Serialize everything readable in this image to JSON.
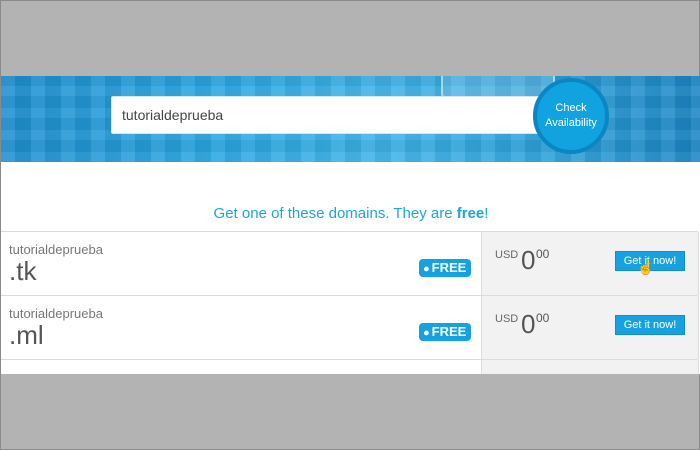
{
  "search": {
    "value": "tutorialdeprueba",
    "button_label": "Check Availability"
  },
  "headline": {
    "prefix": "Get one of these domains. They are ",
    "emphasis": "free",
    "suffix": "!"
  },
  "domains": [
    {
      "sld": "tutorialdeprueba",
      "tld": ".tk",
      "badge": "FREE",
      "currency": "USD",
      "price": "0",
      "cents": "00",
      "button": "Get it now!"
    },
    {
      "sld": "tutorialdeprueba",
      "tld": ".ml",
      "badge": "FREE",
      "currency": "USD",
      "price": "0",
      "cents": "00",
      "button": "Get it now!"
    }
  ],
  "colors": {
    "accent": "#16a2e0",
    "banner": "#2aa6e0",
    "letterbox": "#b3b3b3"
  },
  "icons": {
    "cursor": "hand-pointer-icon",
    "badge_bullet": "bullet-icon"
  }
}
